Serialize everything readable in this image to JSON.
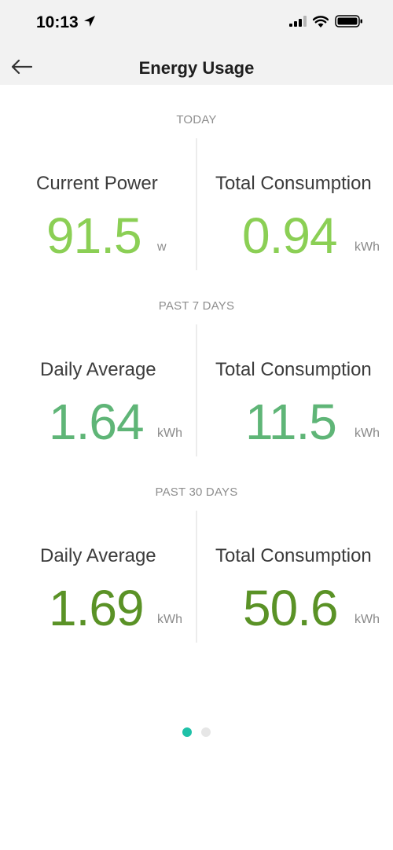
{
  "status_bar": {
    "time": "10:13",
    "icons": [
      "location-arrow-icon",
      "signal-icon",
      "wifi-icon",
      "battery-icon"
    ]
  },
  "nav": {
    "back_icon": "back-arrow-icon",
    "title": "Energy Usage"
  },
  "sections": [
    {
      "label": "TODAY",
      "left": {
        "label": "Current Power",
        "value": "91.5",
        "unit": "w"
      },
      "right": {
        "label": "Total Consumption",
        "value": "0.94",
        "unit": "kWh"
      }
    },
    {
      "label": "PAST 7 DAYS",
      "left": {
        "label": "Daily Average",
        "value": "1.64",
        "unit": "kWh"
      },
      "right": {
        "label": "Total Consumption",
        "value": "11.5",
        "unit": "kWh"
      }
    },
    {
      "label": "PAST 30 DAYS",
      "left": {
        "label": "Daily Average",
        "value": "1.69",
        "unit": "kWh"
      },
      "right": {
        "label": "Total Consumption",
        "value": "50.6",
        "unit": "kWh"
      }
    }
  ],
  "pager": {
    "active_index": 0,
    "count": 2,
    "active_color": "#1fc1a8",
    "inactive_color": "#e6e6e6"
  },
  "colors": {
    "today": "#8bcf55",
    "past7": "#5fb577",
    "past30": "#5a9226"
  }
}
